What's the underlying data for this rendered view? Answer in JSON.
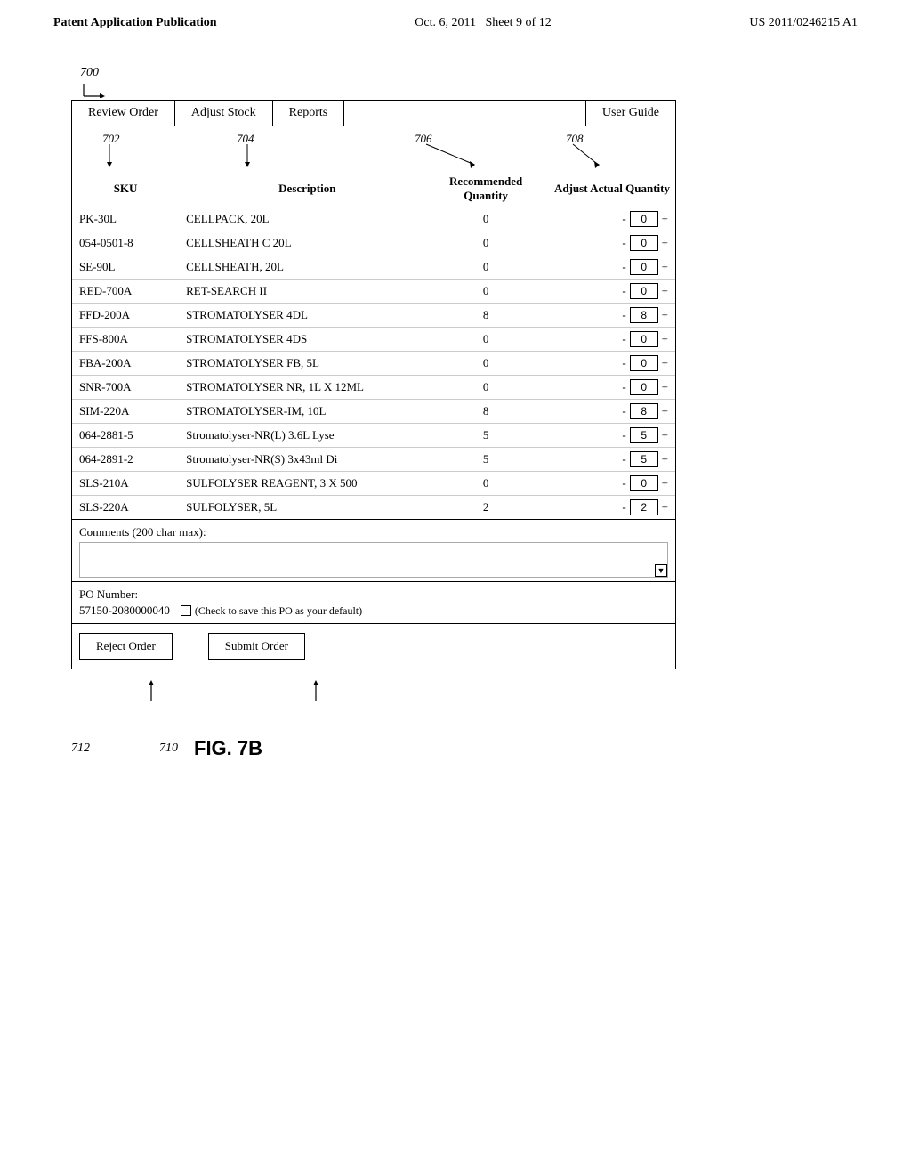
{
  "header": {
    "left": "Patent Application Publication",
    "center": "Oct. 6, 2011",
    "sheet": "Sheet 9 of 12",
    "right": "US 2011/0246215 A1"
  },
  "diagram_ref": "700",
  "tabs": [
    {
      "label": "Review Order",
      "active": false
    },
    {
      "label": "Adjust Stock",
      "active": false
    },
    {
      "label": "Reports",
      "active": true
    },
    {
      "label": "User Guide",
      "active": false
    }
  ],
  "columns": {
    "sku": {
      "label": "SKU",
      "ref": "702"
    },
    "description": {
      "label": "Description",
      "ref": "704"
    },
    "recommended_qty": {
      "label": "Recommended Quantity",
      "ref": "706"
    },
    "adjust_actual_qty": {
      "label": "Adjust Actual Quantity",
      "ref": "708"
    }
  },
  "rows": [
    {
      "sku": "PK-30L",
      "description": "CELLPACK, 20L",
      "rec_qty": "0",
      "adj_qty": "0"
    },
    {
      "sku": "054-0501-8",
      "description": "CELLSHEATH C 20L",
      "rec_qty": "0",
      "adj_qty": "0"
    },
    {
      "sku": "SE-90L",
      "description": "CELLSHEATH, 20L",
      "rec_qty": "0",
      "adj_qty": "0"
    },
    {
      "sku": "RED-700A",
      "description": "RET-SEARCH II",
      "rec_qty": "0",
      "adj_qty": "0"
    },
    {
      "sku": "FFD-200A",
      "description": "STROMATOLYSER 4DL",
      "rec_qty": "8",
      "adj_qty": "8"
    },
    {
      "sku": "FFS-800A",
      "description": "STROMATOLYSER 4DS",
      "rec_qty": "0",
      "adj_qty": "0"
    },
    {
      "sku": "FBA-200A",
      "description": "STROMATOLYSER FB, 5L",
      "rec_qty": "0",
      "adj_qty": "0"
    },
    {
      "sku": "SNR-700A",
      "description": "STROMATOLYSER NR, 1L X 12ML",
      "rec_qty": "0",
      "adj_qty": "0"
    },
    {
      "sku": "SIM-220A",
      "description": "STROMATOLYSER-IM, 10L",
      "rec_qty": "8",
      "adj_qty": "8"
    },
    {
      "sku": "064-2881-5",
      "description": "Stromatolyser-NR(L) 3.6L Lyse",
      "rec_qty": "5",
      "adj_qty": "5"
    },
    {
      "sku": "064-2891-2",
      "description": "Stromatolyser-NR(S) 3x43ml Di",
      "rec_qty": "5",
      "adj_qty": "5"
    },
    {
      "sku": "SLS-210A",
      "description": "SULFOLYSER REAGENT, 3 X 500",
      "rec_qty": "0",
      "adj_qty": "0"
    },
    {
      "sku": "SLS-220A",
      "description": "SULFOLYSER, 5L",
      "rec_qty": "2",
      "adj_qty": "2"
    }
  ],
  "comments": {
    "label": "Comments  (200 char max):"
  },
  "po_section": {
    "label": "PO Number:",
    "number": "57150-2080000040",
    "check_label": "(Check to save this PO as your default)"
  },
  "buttons": {
    "reject": "Reject Order",
    "submit": "Submit Order"
  },
  "figure": {
    "ref_reject": "712",
    "ref_submit": "710",
    "title": "FIG. 7B"
  }
}
